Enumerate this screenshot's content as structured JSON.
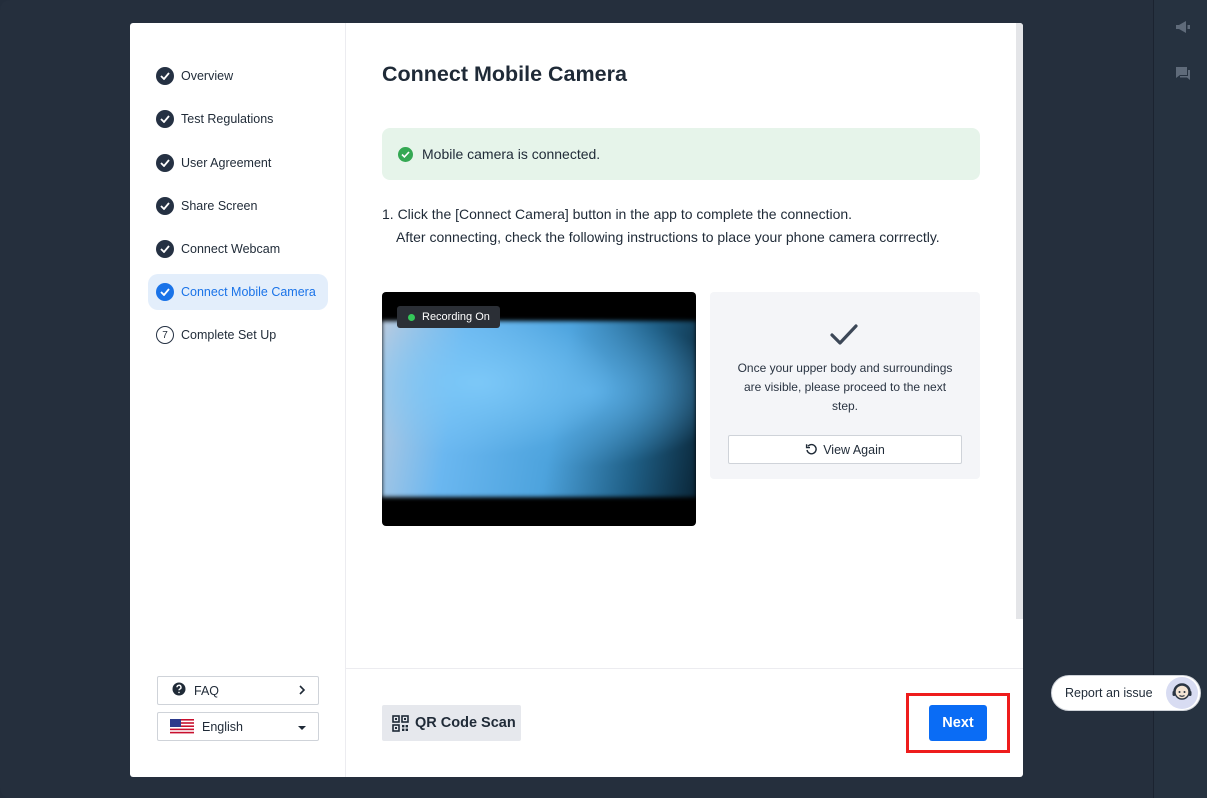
{
  "steps": [
    {
      "label": "Overview",
      "state": "done"
    },
    {
      "label": "Test Regulations",
      "state": "done"
    },
    {
      "label": "User Agreement",
      "state": "done"
    },
    {
      "label": "Share Screen",
      "state": "done"
    },
    {
      "label": "Connect Webcam",
      "state": "done"
    },
    {
      "label": "Connect Mobile Camera",
      "state": "active"
    },
    {
      "label": "Complete Set Up",
      "state": "pending",
      "number": "7"
    }
  ],
  "sidebar": {
    "faq_label": "FAQ",
    "language_label": "English"
  },
  "main": {
    "title": "Connect Mobile Camera",
    "status_message": "Mobile camera is connected.",
    "instruction_line1": "1. Click the [Connect Camera] button in the app to complete the connection.",
    "instruction_line2": "After connecting, check the following instructions to place your phone camera corrrectly.",
    "recording_badge": "Recording On",
    "guide_text": "Once your upper body and surroundings are visible, please proceed to the next step.",
    "view_again_label": "View Again"
  },
  "footer": {
    "qr_label": "QR Code Scan",
    "next_label": "Next"
  },
  "report": {
    "label": "Report an issue"
  },
  "colors": {
    "accent": "#0a6cf5",
    "success": "#34a853",
    "highlight": "#ee1c1c"
  }
}
